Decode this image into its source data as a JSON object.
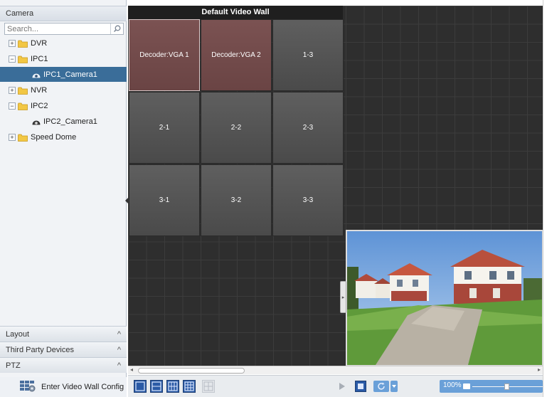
{
  "left_panel": {
    "camera_header": "Camera",
    "search_placeholder": "Search...",
    "tree": [
      {
        "label": "DVR",
        "expander": "+"
      },
      {
        "label": "IPC1",
        "expander": "−"
      },
      {
        "label": "IPC1_Camera1"
      },
      {
        "label": "NVR",
        "expander": "+"
      },
      {
        "label": "IPC2",
        "expander": "−"
      },
      {
        "label": "IPC2_Camera1"
      },
      {
        "label": "Speed Dome",
        "expander": "+"
      }
    ],
    "accordions": [
      {
        "label": "Layout",
        "chevron": "^"
      },
      {
        "label": "Third Party Devices",
        "chevron": "^"
      },
      {
        "label": "PTZ",
        "chevron": "^"
      }
    ],
    "enter_vw_label": "Enter Video Wall Config"
  },
  "wall": {
    "title": "Default Video Wall",
    "cells": [
      "Decoder:VGA 1",
      "Decoder:VGA 2",
      "1-3",
      "2-1",
      "2-2",
      "2-3",
      "3-1",
      "3-2",
      "3-3"
    ]
  },
  "toolbar": {
    "zoom": "100%"
  },
  "colors": {
    "selected_row": "#3a6d99",
    "decoder_cell": "#7b5252",
    "empty_cell": "#555555",
    "grid_bg": "#2e2e2e",
    "zoom_accent": "#6aa0d8"
  }
}
